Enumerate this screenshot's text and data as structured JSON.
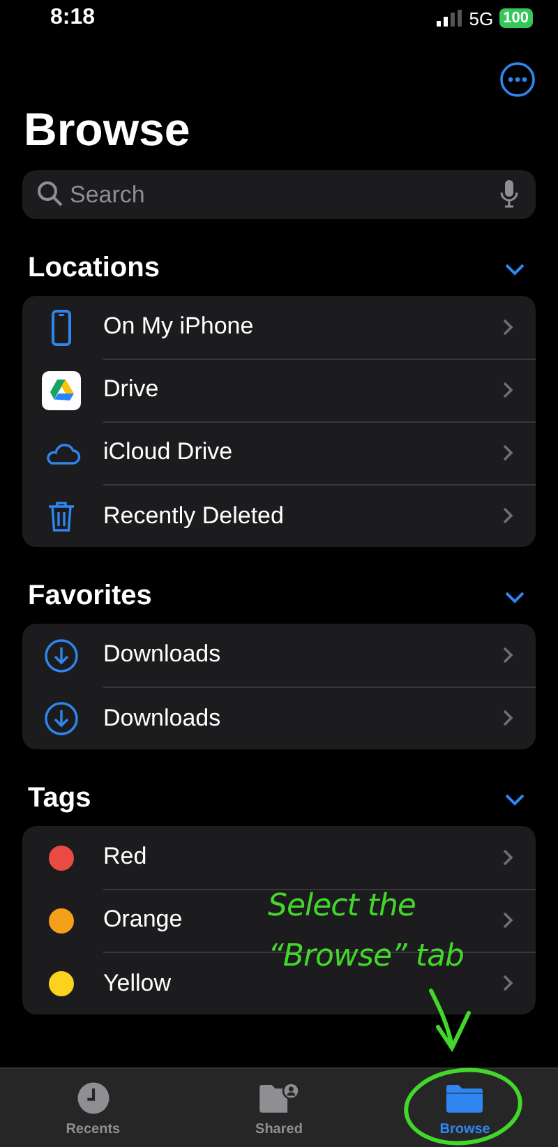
{
  "status_bar": {
    "time": "8:18",
    "network": "5G",
    "battery": "100"
  },
  "title": "Browse",
  "search": {
    "placeholder": "Search"
  },
  "sections": [
    {
      "title": "Locations",
      "expanded": true,
      "items": [
        {
          "kind": "phone",
          "label": "On My iPhone"
        },
        {
          "kind": "drive",
          "label": "Drive"
        },
        {
          "kind": "cloud",
          "label": "iCloud Drive"
        },
        {
          "kind": "trash",
          "label": "Recently Deleted"
        }
      ]
    },
    {
      "title": "Favorites",
      "expanded": true,
      "items": [
        {
          "kind": "download",
          "label": "Downloads"
        },
        {
          "kind": "download",
          "label": "Downloads"
        }
      ]
    },
    {
      "title": "Tags",
      "expanded": true,
      "items": [
        {
          "kind": "tag",
          "label": "Red",
          "color": "#eb4a42"
        },
        {
          "kind": "tag",
          "label": "Orange",
          "color": "#f5a01a"
        },
        {
          "kind": "tag",
          "label": "Yellow",
          "color": "#fbd21e"
        }
      ]
    }
  ],
  "tab_bar": [
    {
      "kind": "clock",
      "label": "Recents",
      "selected": false
    },
    {
      "kind": "shared",
      "label": "Shared",
      "selected": false
    },
    {
      "kind": "folder",
      "label": "Browse",
      "selected": true
    }
  ],
  "annotation": {
    "text": "Select the “Browse” tab"
  }
}
